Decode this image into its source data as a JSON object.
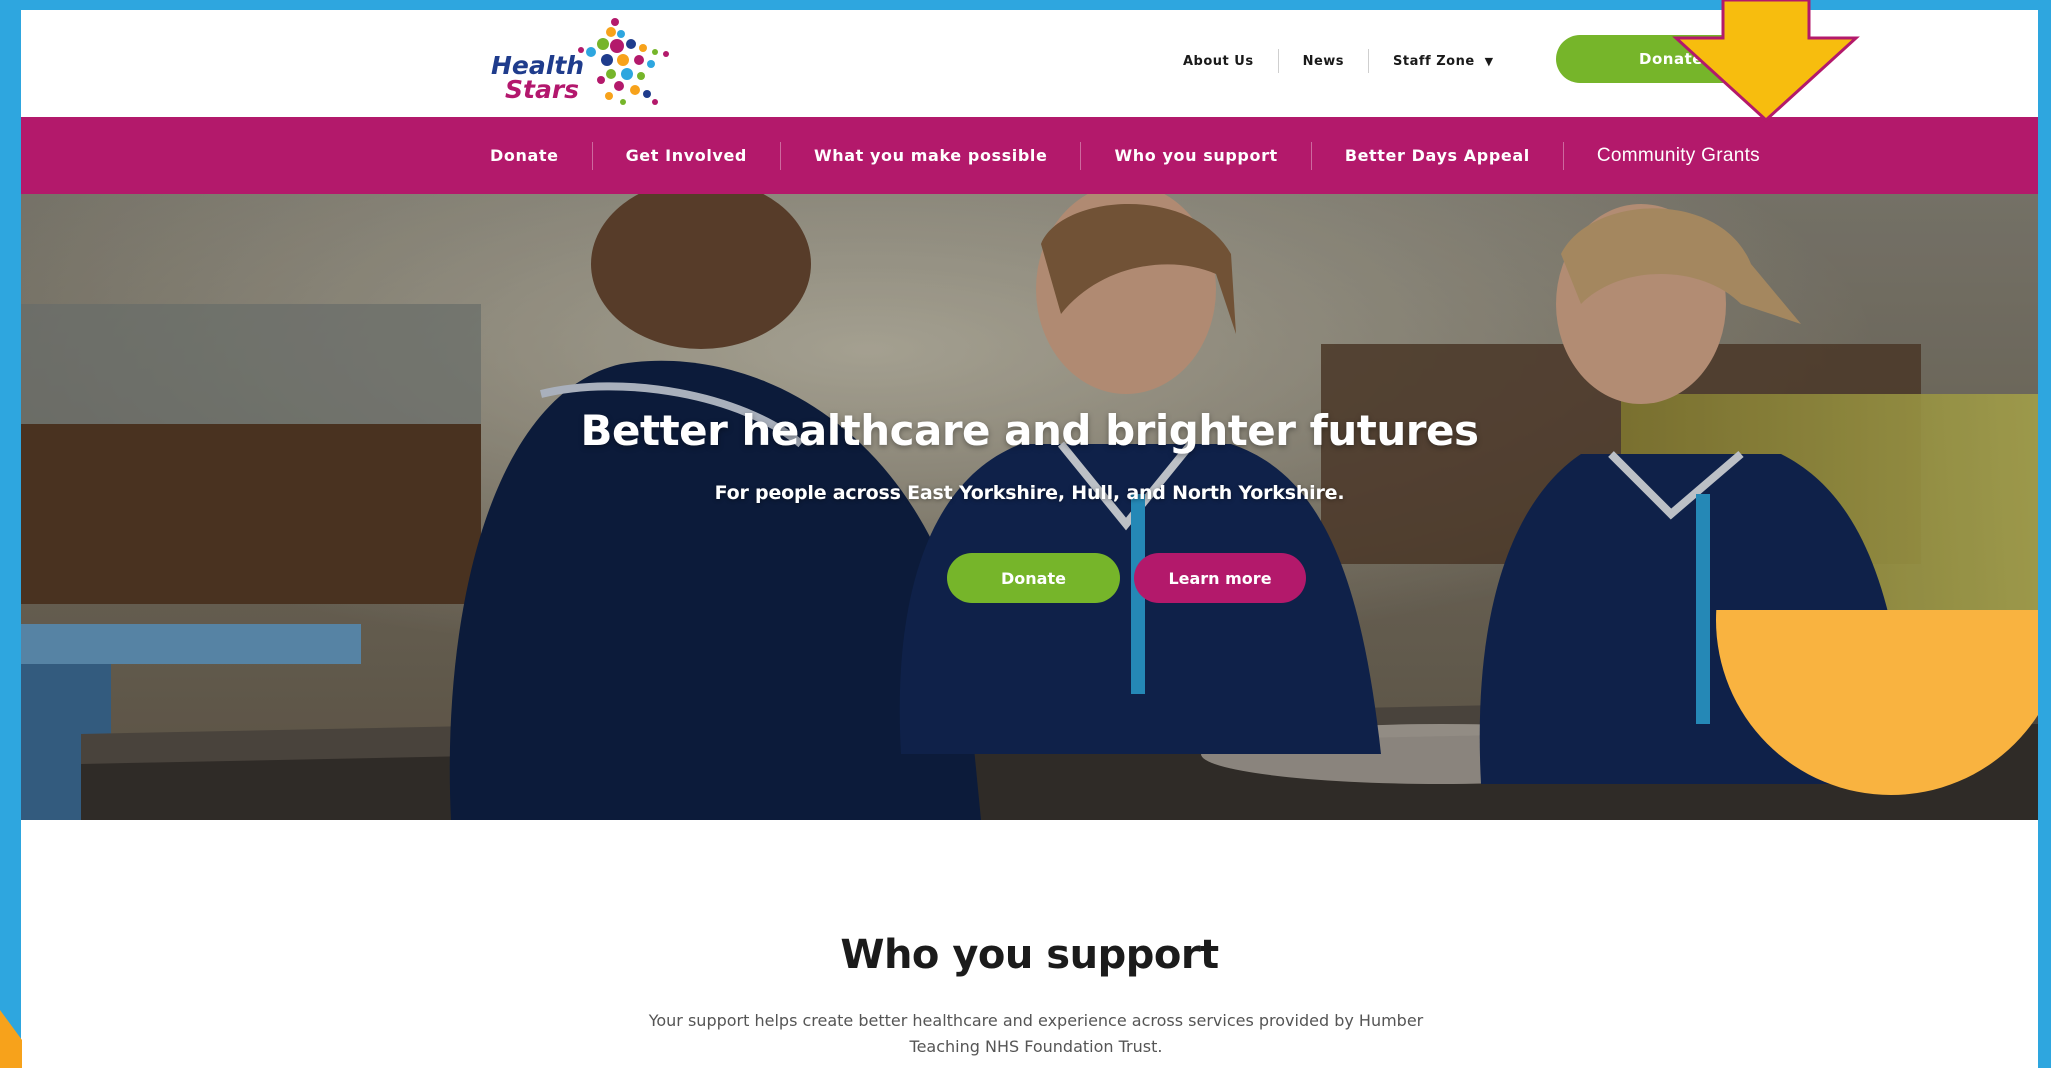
{
  "logo": {
    "line1": "Health",
    "line2": "Stars"
  },
  "header": {
    "about": "About Us",
    "news": "News",
    "staff_zone": "Staff Zone",
    "donate": "Donate"
  },
  "nav": {
    "items": [
      "Donate",
      "Get Involved",
      "What you make possible",
      "Who you support",
      "Better Days Appeal",
      "Community Grants"
    ]
  },
  "hero": {
    "title": "Better healthcare and brighter futures",
    "subtitle": "For people across East Yorkshire, Hull, and North Yorkshire.",
    "donate_label": "Donate",
    "learn_label": "Learn more"
  },
  "section": {
    "title": "Who you support",
    "description": "Your support helps create better healthcare and experience across services provided by Humber Teaching NHS Foundation Trust."
  },
  "colors": {
    "brand_magenta": "#b3196b",
    "brand_green": "#76b52a",
    "brand_navy": "#1f3c8c",
    "frame_blue": "#2ea6df",
    "arrow_yellow": "#f7bd0e",
    "blob_orange": "#f9b340"
  },
  "icons": {
    "caret": "chevron-down-icon",
    "annotation": "down-arrow-icon"
  }
}
